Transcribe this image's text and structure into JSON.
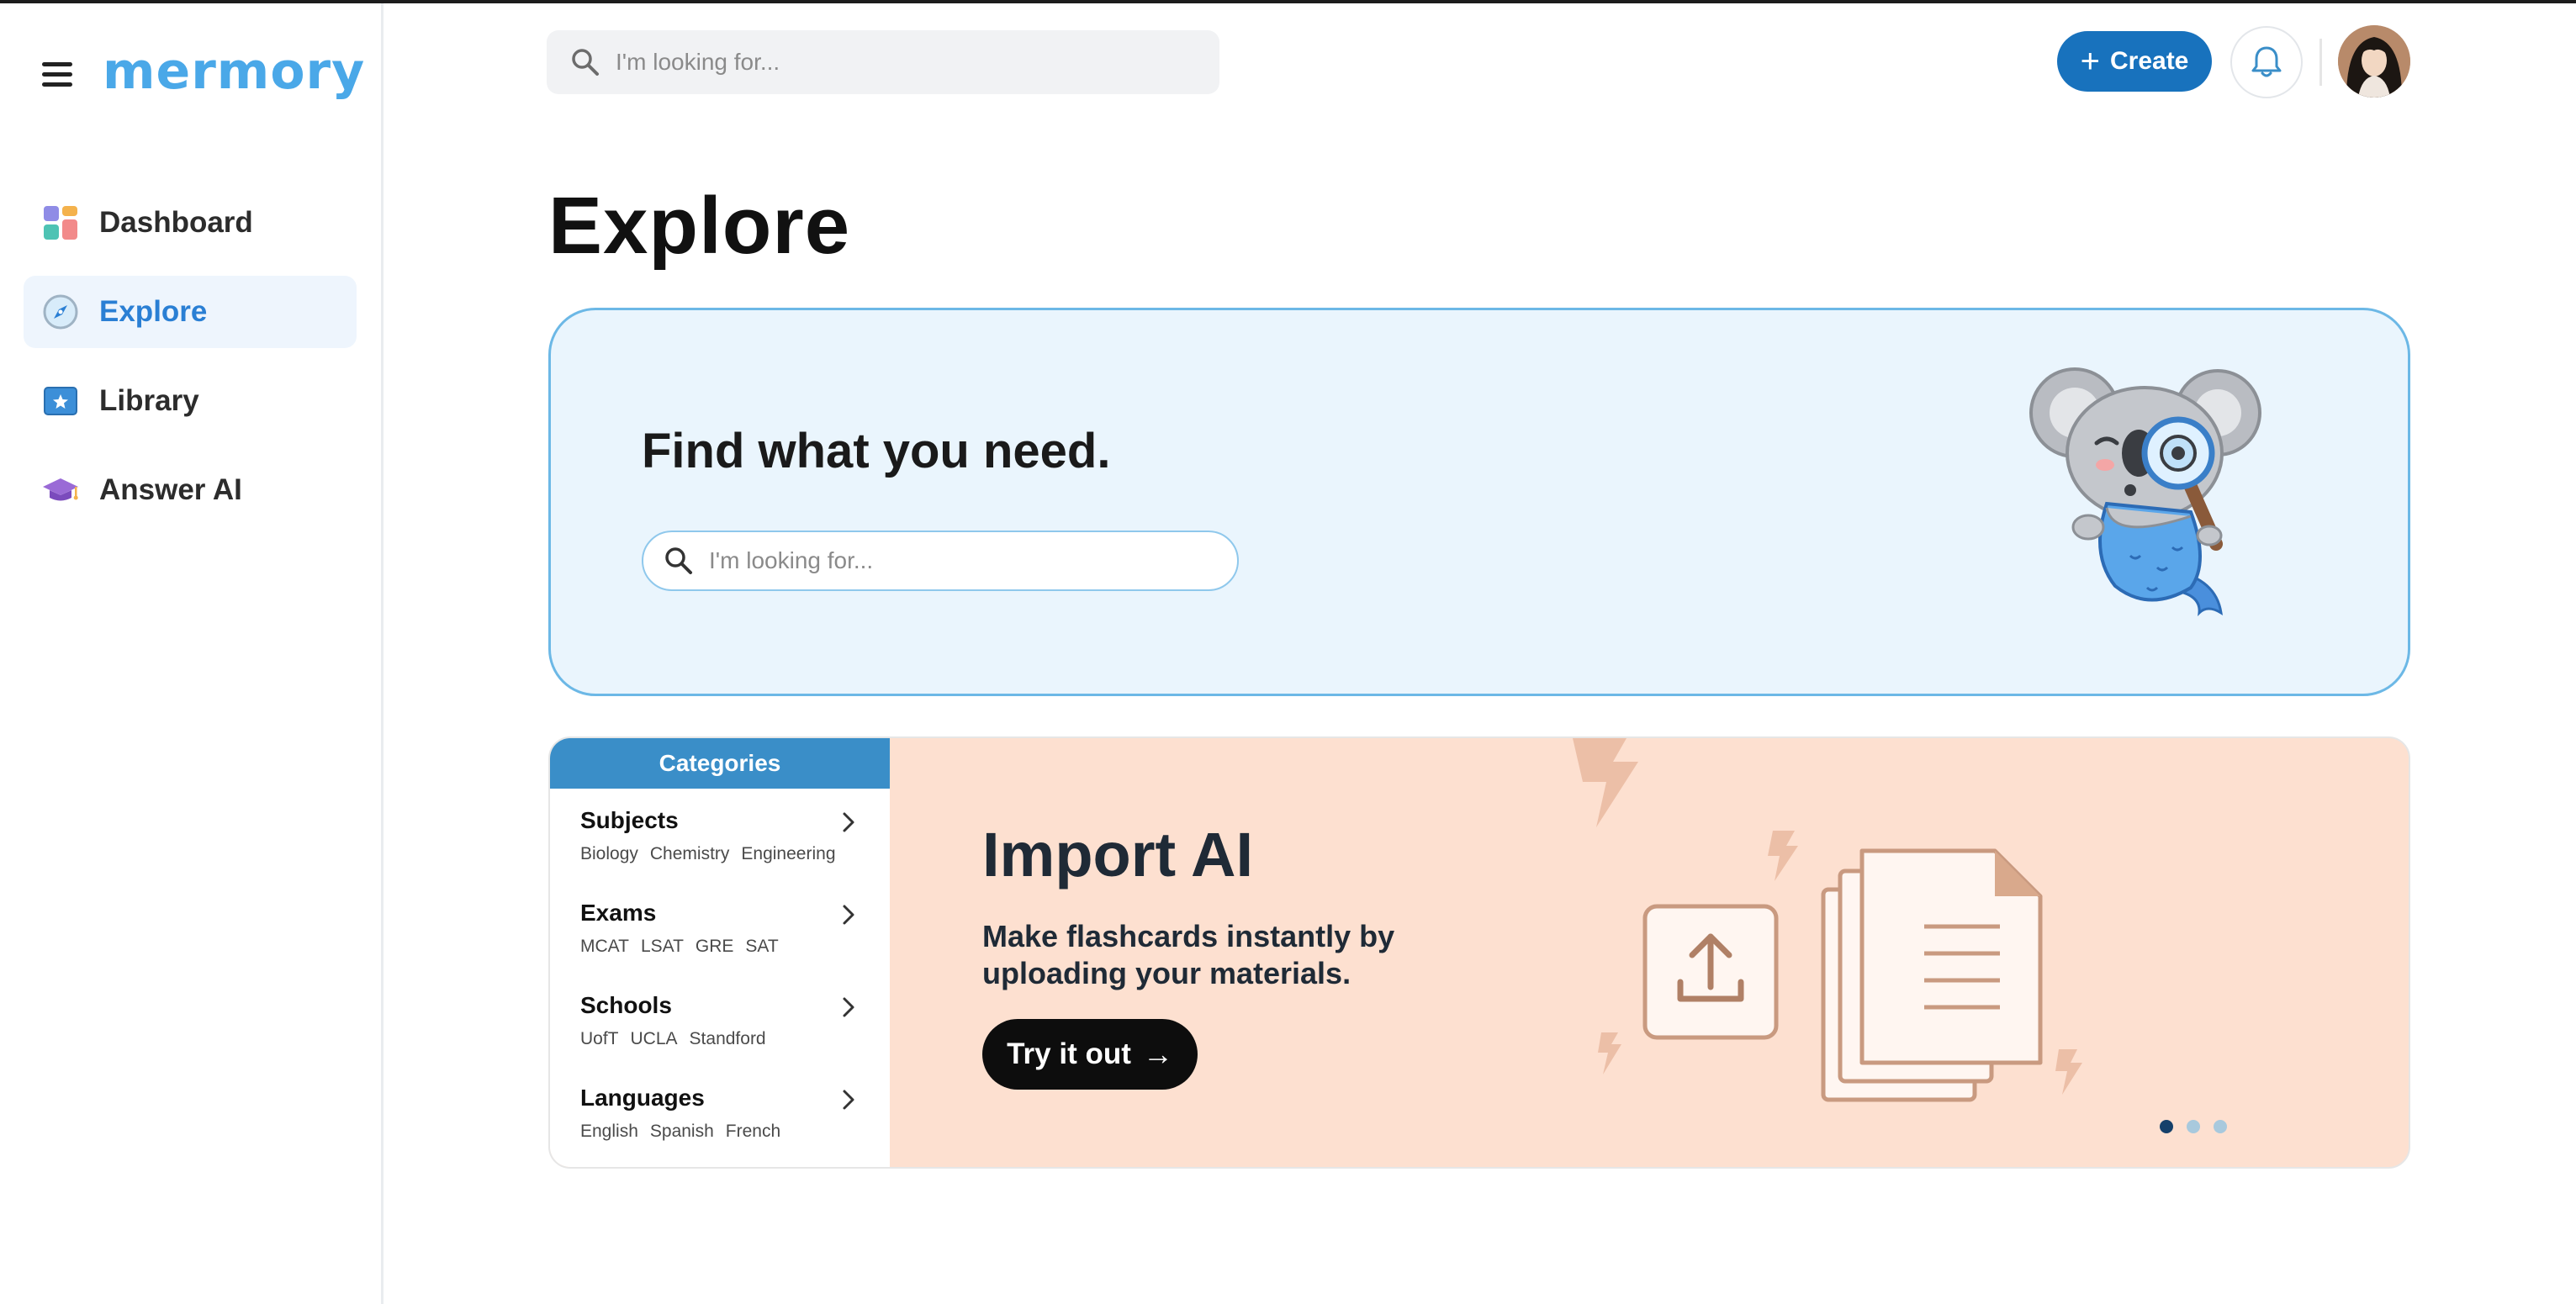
{
  "app": {
    "logo": "mermory"
  },
  "sidebar": {
    "items": [
      {
        "label": "Dashboard",
        "icon": "dashboard-icon",
        "active": false
      },
      {
        "label": "Explore",
        "icon": "compass-icon",
        "active": true
      },
      {
        "label": "Library",
        "icon": "library-icon",
        "active": false
      },
      {
        "label": "Answer AI",
        "icon": "graduation-cap-icon",
        "active": false
      }
    ]
  },
  "topbar": {
    "search_placeholder": "I'm looking for...",
    "create_label": "Create"
  },
  "page": {
    "title": "Explore"
  },
  "hero": {
    "heading": "Find what you need.",
    "search_placeholder": "I'm looking for..."
  },
  "categories": {
    "header": "Categories",
    "items": [
      {
        "name": "Subjects",
        "tags": [
          "Biology",
          "Chemistry",
          "Engineering"
        ]
      },
      {
        "name": "Exams",
        "tags": [
          "MCAT",
          "LSAT",
          "GRE",
          "SAT"
        ]
      },
      {
        "name": "Schools",
        "tags": [
          "UofT",
          "UCLA",
          "Standford"
        ]
      },
      {
        "name": "Languages",
        "tags": [
          "English",
          "Spanish",
          "French"
        ]
      }
    ]
  },
  "promo": {
    "title": "Import AI",
    "subtitle": "Make flashcards instantly by uploading your materials.",
    "cta_label": "Try it out",
    "slide_count": 3,
    "active_slide": 1
  },
  "colors": {
    "brand": "#4aa8e8",
    "primary_button": "#1872bd",
    "hero_bg": "#eaf5fd",
    "promo_bg": "#fde0d0",
    "categories_header": "#3a8ec8"
  }
}
